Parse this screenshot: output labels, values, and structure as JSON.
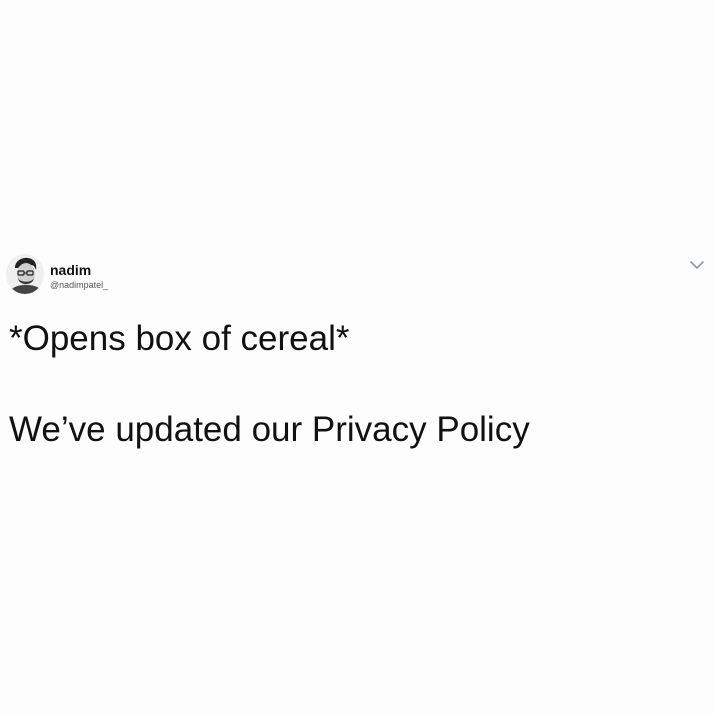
{
  "tweet": {
    "author": {
      "display_name": "nadim",
      "handle": "@nadimpatel_",
      "avatar_icon": "user-avatar-icon"
    },
    "menu_icon": "chevron-down-icon",
    "text_lines": [
      "*Opens box of cereal*",
      "We’ve updated our Privacy Policy"
    ]
  },
  "colors": {
    "background": "#fdfdfd",
    "text": "#111111",
    "handle": "#555555",
    "chevron": "#8899a6"
  }
}
